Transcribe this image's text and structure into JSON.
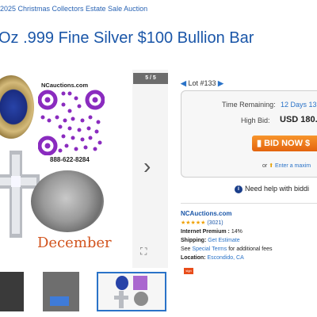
{
  "breadcrumb": "2025 Christmas Collectors Estate Sale Auction",
  "title": "Oz .999 Fine Silver $100 Bullion Bar",
  "gallery": {
    "counter": "5 / 5",
    "brand_text": "NCauctions.com",
    "phone": "888-622-8284",
    "month_text": "December"
  },
  "lot": {
    "label": "Lot #133"
  },
  "bid_panel": {
    "time_remaining_label": "Time Remaining:",
    "time_remaining_value": "12 Days 13",
    "high_bid_label": "High Bid:",
    "high_bid_value": "USD 180.",
    "bid_button": "BID NOW $",
    "or_text": "or",
    "max_link": "Enter a maxim"
  },
  "help_text": "Need help with biddi",
  "seller": {
    "name": "NCAuctions.com",
    "stars": "★★★★★",
    "rating_count": "(3021)",
    "premium_label": "Internet Premium :",
    "premium_value": "14%",
    "shipping_label": "Shipping:",
    "shipping_link": "Get Estimate",
    "terms_prefix": "See",
    "terms_link": "Special Terms",
    "terms_suffix": "for additional fees",
    "location_label": "Location:",
    "location_value": "Escondido, CA",
    "badge": "sign"
  },
  "colors": {
    "link": "#2a73c8",
    "title": "#1a56a8",
    "bid_button": "#f7952c"
  }
}
